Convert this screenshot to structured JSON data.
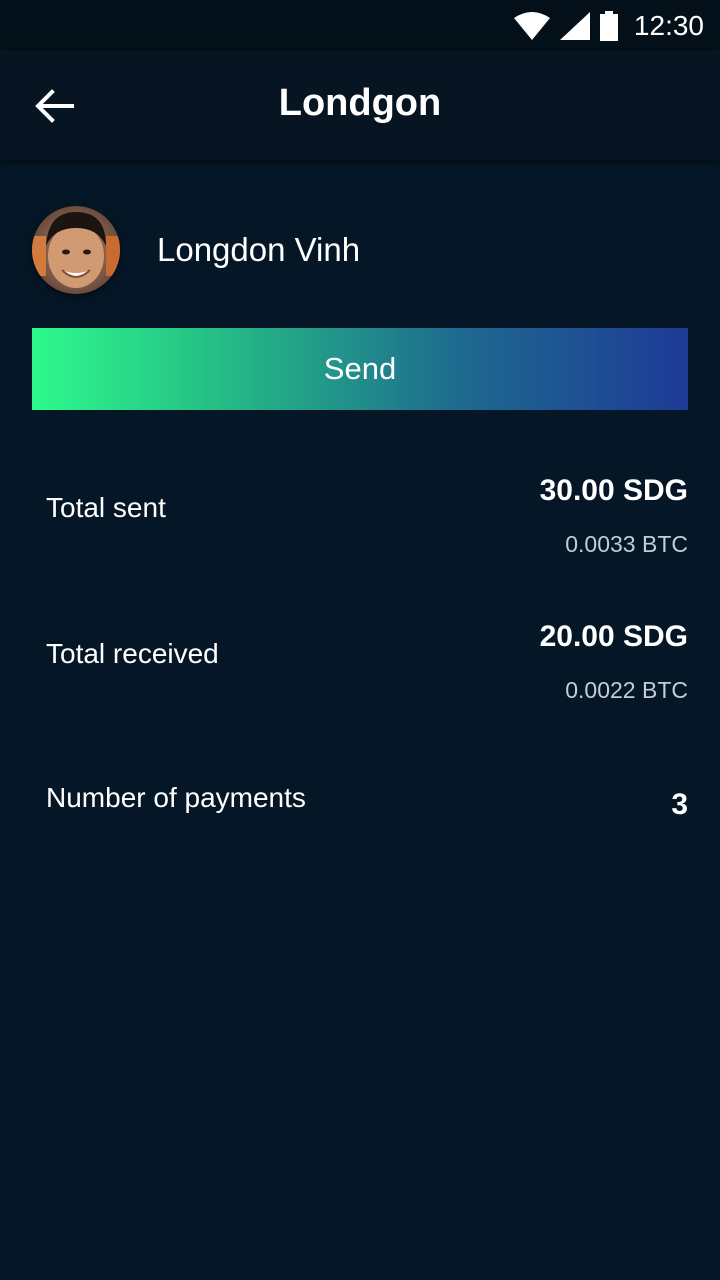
{
  "status_bar": {
    "time": "12:30",
    "icons": [
      "wifi-icon",
      "cellular-signal-icon",
      "battery-icon"
    ]
  },
  "app_bar": {
    "title": "Londgon",
    "back_icon": "arrow-left-icon"
  },
  "profile": {
    "name": "Longdon Vinh"
  },
  "send_button": {
    "label": "Send",
    "gradient_colors": [
      "#2dfa8c",
      "#1e3a97"
    ]
  },
  "stats": {
    "total_sent": {
      "label": "Total sent",
      "amount": "30.00 SDG",
      "btc": "0.0033 BTC"
    },
    "total_received": {
      "label": "Total received",
      "amount": "20.00 SDG",
      "btc": "0.0022 BTC"
    },
    "payments": {
      "label": "Number of payments",
      "count": "3"
    }
  },
  "colors": {
    "background": "#051726",
    "app_bar": "#071421",
    "status_bar": "#031019"
  }
}
